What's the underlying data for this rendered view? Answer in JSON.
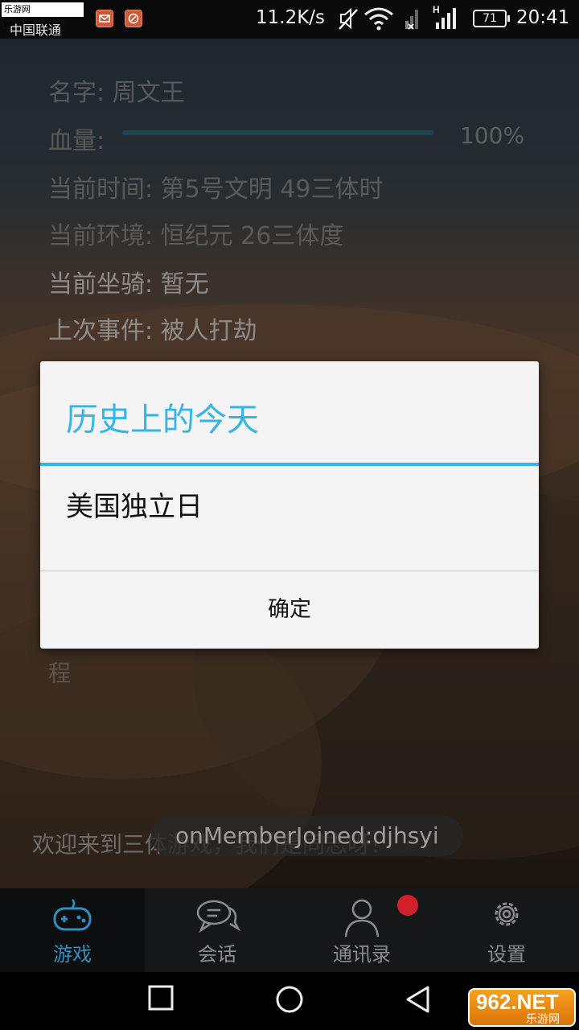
{
  "status": {
    "watermark": "乐游网 www.962.net",
    "carrier": "中国联通",
    "net_speed": "11.2K/s",
    "battery": "71",
    "time": "20:41"
  },
  "profile": {
    "name": "名字: 周文王",
    "hp_label": "血量:",
    "hp_percent": 100,
    "hp_text": "100%",
    "current_time": "当前时间: 第5号文明 49三体时",
    "environment": "当前环境: 恒纪元 26三体度",
    "mount": "当前坐骑: 暂无",
    "last_event": "上次事件: 被人打劫"
  },
  "background_text": {
    "hidden_line_end": "程",
    "welcome": "欢迎来到三体游戏，我们是同志呀！"
  },
  "toast": "onMemberJoined:djhsyi",
  "dialog": {
    "title": "历史上的今天",
    "message": "美国独立日",
    "confirm": "确定"
  },
  "tabs": [
    {
      "label": "游戏",
      "icon": "gamepad-icon",
      "active": true
    },
    {
      "label": "会话",
      "icon": "chat-bubbles-icon",
      "active": false
    },
    {
      "label": "通讯录",
      "icon": "contact-person-icon",
      "active": false,
      "badge": true
    },
    {
      "label": "设置",
      "icon": "gear-icon",
      "active": false
    }
  ],
  "watermark_br": {
    "big": "962.NET",
    "small": "乐游网"
  },
  "colors": {
    "accent": "#33b5e5",
    "tab_active": "#2f8fbf",
    "badge": "#d0202a"
  }
}
